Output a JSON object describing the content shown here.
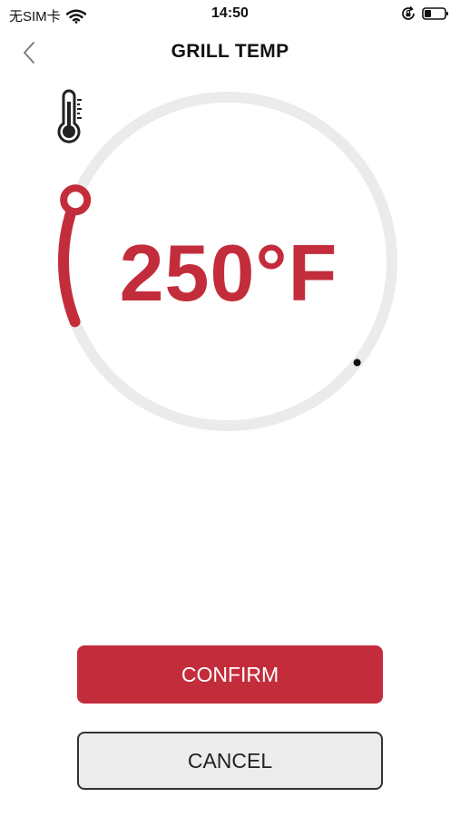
{
  "status_bar": {
    "carrier": "无SIM卡",
    "time": "14:50",
    "icons": [
      "wifi-icon",
      "rotation-lock-icon",
      "battery-icon"
    ]
  },
  "header": {
    "back_icon": "chevron-left-icon",
    "title": "GRILL TEMP"
  },
  "dial": {
    "icon": "thermometer-icon",
    "temperature": "250°F",
    "level_fraction": 0.15,
    "track_color": "#ebebeb",
    "accent_color": "#c32d3b"
  },
  "actions": {
    "confirm_label": "CONFIRM",
    "cancel_label": "CANCEL"
  }
}
